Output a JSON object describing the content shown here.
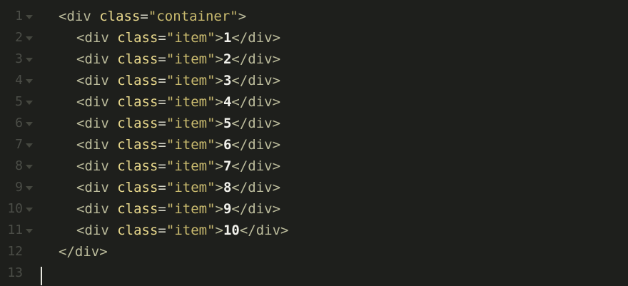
{
  "editor": {
    "lines": [
      {
        "number": "1",
        "indent": "",
        "text": "",
        "tag_open": "<div",
        "attr": "class",
        "eq": "=",
        "value": "\"container\"",
        "tag_after": ">",
        "content": "",
        "tag_close": "",
        "foldable": true
      },
      {
        "number": "2",
        "indent": "  ",
        "tag_open": "<div",
        "attr": "class",
        "eq": "=",
        "value": "\"item\"",
        "tag_after": ">",
        "content": "1",
        "tag_close": "</div>",
        "foldable": true
      },
      {
        "number": "3",
        "indent": "  ",
        "tag_open": "<div",
        "attr": "class",
        "eq": "=",
        "value": "\"item\"",
        "tag_after": ">",
        "content": "2",
        "tag_close": "</div>",
        "foldable": true
      },
      {
        "number": "4",
        "indent": "  ",
        "tag_open": "<div",
        "attr": "class",
        "eq": "=",
        "value": "\"item\"",
        "tag_after": ">",
        "content": "3",
        "tag_close": "</div>",
        "foldable": true
      },
      {
        "number": "5",
        "indent": "  ",
        "tag_open": "<div",
        "attr": "class",
        "eq": "=",
        "value": "\"item\"",
        "tag_after": ">",
        "content": "4",
        "tag_close": "</div>",
        "foldable": true
      },
      {
        "number": "6",
        "indent": "  ",
        "tag_open": "<div",
        "attr": "class",
        "eq": "=",
        "value": "\"item\"",
        "tag_after": ">",
        "content": "5",
        "tag_close": "</div>",
        "foldable": true
      },
      {
        "number": "7",
        "indent": "  ",
        "tag_open": "<div",
        "attr": "class",
        "eq": "=",
        "value": "\"item\"",
        "tag_after": ">",
        "content": "6",
        "tag_close": "</div>",
        "foldable": true
      },
      {
        "number": "8",
        "indent": "  ",
        "tag_open": "<div",
        "attr": "class",
        "eq": "=",
        "value": "\"item\"",
        "tag_after": ">",
        "content": "7",
        "tag_close": "</div>",
        "foldable": true
      },
      {
        "number": "9",
        "indent": "  ",
        "tag_open": "<div",
        "attr": "class",
        "eq": "=",
        "value": "\"item\"",
        "tag_after": ">",
        "content": "8",
        "tag_close": "</div>",
        "foldable": true
      },
      {
        "number": "10",
        "indent": "  ",
        "tag_open": "<div",
        "attr": "class",
        "eq": "=",
        "value": "\"item\"",
        "tag_after": ">",
        "content": "9",
        "tag_close": "</div>",
        "foldable": true
      },
      {
        "number": "11",
        "indent": "  ",
        "tag_open": "<div",
        "attr": "class",
        "eq": "=",
        "value": "\"item\"",
        "tag_after": ">",
        "content": "10",
        "tag_close": "</div>",
        "foldable": true
      },
      {
        "number": "12",
        "indent": "",
        "tag_open": "</div>",
        "attr": "",
        "eq": "",
        "value": "",
        "tag_after": "",
        "content": "",
        "tag_close": "",
        "foldable": false
      },
      {
        "number": "13",
        "indent": "",
        "tag_open": "",
        "attr": "",
        "eq": "",
        "value": "",
        "tag_after": "",
        "content": "",
        "tag_close": "",
        "foldable": false
      }
    ],
    "colors": {
      "background": "#1e1f1c",
      "line_number": "#4b4d47",
      "tag": "#bcbc9c",
      "attribute": "#e8d88c",
      "string": "#c9ba6e",
      "text": "#f2f2ec"
    },
    "icons": {
      "fold": "chevron-down-icon",
      "cursor": "text-cursor"
    }
  }
}
